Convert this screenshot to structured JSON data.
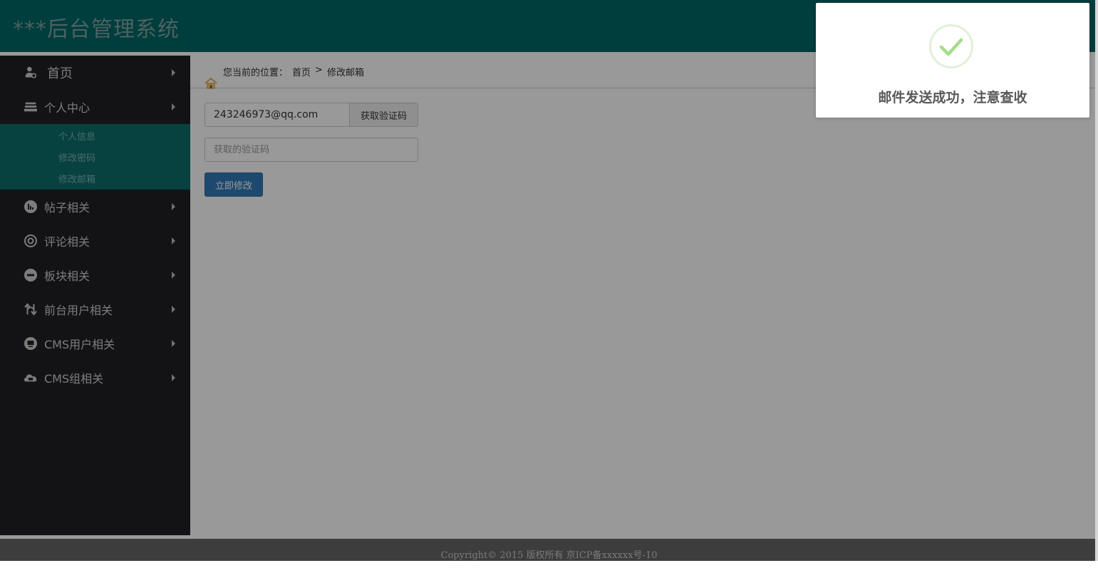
{
  "header": {
    "title": "***后台管理系统"
  },
  "sidebar": {
    "items": [
      {
        "label": "首页",
        "icon": "user-gear-icon"
      },
      {
        "label": "个人中心",
        "icon": "stack-icon"
      },
      {
        "label": "帖子相关",
        "icon": "bar-chart-icon"
      },
      {
        "label": "评论相关",
        "icon": "settings-icon"
      },
      {
        "label": "板块相关",
        "icon": "app-icon"
      },
      {
        "label": "前台用户相关",
        "icon": "swap-icon"
      },
      {
        "label": "CMS用户相关",
        "icon": "monitor-icon"
      },
      {
        "label": "CMS组相关",
        "icon": "cloud-icon"
      }
    ],
    "submenu": [
      {
        "label": "个人信息"
      },
      {
        "label": "修改密码"
      },
      {
        "label": "修改邮箱"
      }
    ]
  },
  "breadcrumb": {
    "prefix": "您当前的位置：",
    "home": "首页",
    "separator": ">",
    "current": "修改邮箱"
  },
  "form": {
    "email_value": "243246973@qq.com",
    "get_code_label": "获取验证码",
    "code_placeholder": "获取的验证码",
    "submit_label": "立即修改"
  },
  "footer": {
    "text": "Copyright© 2015 版权所有 京ICP备xxxxxx号-10"
  },
  "toast": {
    "message": "邮件发送成功，注意查收",
    "icon": "success-check-icon"
  },
  "colors": {
    "header_bg": "#006666",
    "sidebar_bg": "#212025",
    "submenu_bg": "#0d6f6c",
    "primary_button": "#337ab7",
    "success_check": "#a5dc86"
  }
}
